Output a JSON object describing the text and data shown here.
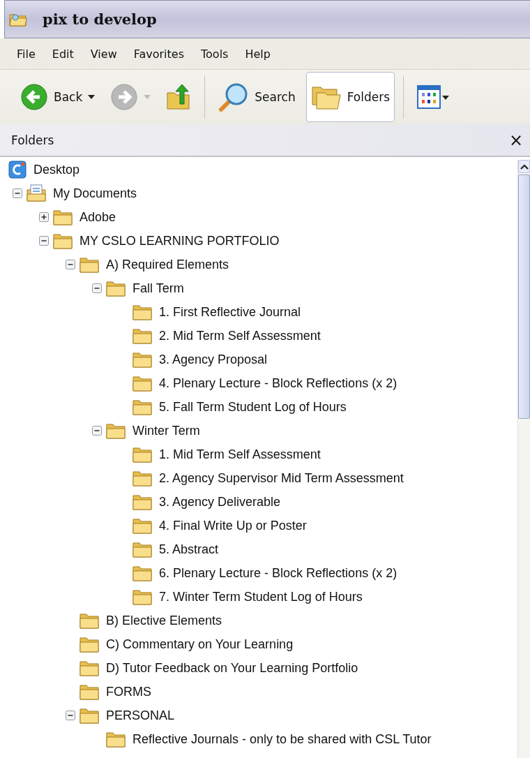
{
  "window": {
    "title": "pix to develop"
  },
  "menu": [
    "File",
    "Edit",
    "View",
    "Favorites",
    "Tools",
    "Help"
  ],
  "toolbar": [
    {
      "kind": "back",
      "label": "Back",
      "disabled": false
    },
    {
      "kind": "forward",
      "disabled": true
    },
    {
      "kind": "up"
    },
    {
      "kind": "search",
      "label": "Search",
      "selected": false
    },
    {
      "kind": "folders",
      "label": "Folders",
      "selected": true
    },
    {
      "kind": "views"
    }
  ],
  "panel": {
    "title": "Folders",
    "close": "×"
  },
  "tree": [
    {
      "label": "Desktop",
      "kind": "desktop",
      "children": [
        {
          "label": "My Documents",
          "kind": "documents",
          "expanded": true,
          "children": [
            {
              "label": "Adobe",
              "kind": "folder",
              "expanded": false
            },
            {
              "label": "MY CSLO LEARNING PORTFOLIO",
              "kind": "folder",
              "expanded": true,
              "children": [
                {
                  "label": "A) Required Elements",
                  "kind": "folder",
                  "expanded": true,
                  "children": [
                    {
                      "label": "Fall Term",
                      "kind": "folder",
                      "expanded": true,
                      "children": [
                        {
                          "label": "1. First Reflective Journal",
                          "kind": "folder"
                        },
                        {
                          "label": "2. Mid Term Self Assessment",
                          "kind": "folder"
                        },
                        {
                          "label": "3. Agency Proposal",
                          "kind": "folder"
                        },
                        {
                          "label": "4. Plenary Lecture - Block Reflections (x 2)",
                          "kind": "folder"
                        },
                        {
                          "label": "5. Fall Term Student Log of Hours",
                          "kind": "folder"
                        }
                      ]
                    },
                    {
                      "label": "Winter Term",
                      "kind": "folder",
                      "expanded": true,
                      "children": [
                        {
                          "label": "1. Mid Term Self Assessment",
                          "kind": "folder"
                        },
                        {
                          "label": "2. Agency Supervisor Mid Term Assessment",
                          "kind": "folder"
                        },
                        {
                          "label": "3. Agency Deliverable",
                          "kind": "folder"
                        },
                        {
                          "label": "4. Final Write Up or Poster",
                          "kind": "folder"
                        },
                        {
                          "label": "5. Abstract",
                          "kind": "folder"
                        },
                        {
                          "label": "6. Plenary Lecture - Block Reflections (x 2)",
                          "kind": "folder"
                        },
                        {
                          "label": "7. Winter Term Student Log of Hours",
                          "kind": "folder"
                        }
                      ]
                    }
                  ]
                },
                {
                  "label": "B) Elective Elements",
                  "kind": "folder"
                },
                {
                  "label": "C) Commentary on Your Learning",
                  "kind": "folder"
                },
                {
                  "label": "D) Tutor Feedback on Your Learning Portfolio",
                  "kind": "folder"
                },
                {
                  "label": "FORMS",
                  "kind": "folder"
                },
                {
                  "label": "PERSONAL",
                  "kind": "folder",
                  "expanded": true,
                  "children": [
                    {
                      "label": "Reflective Journals - only to be shared with CSL Tutor",
                      "kind": "folder"
                    }
                  ]
                }
              ]
            }
          ]
        }
      ]
    }
  ]
}
